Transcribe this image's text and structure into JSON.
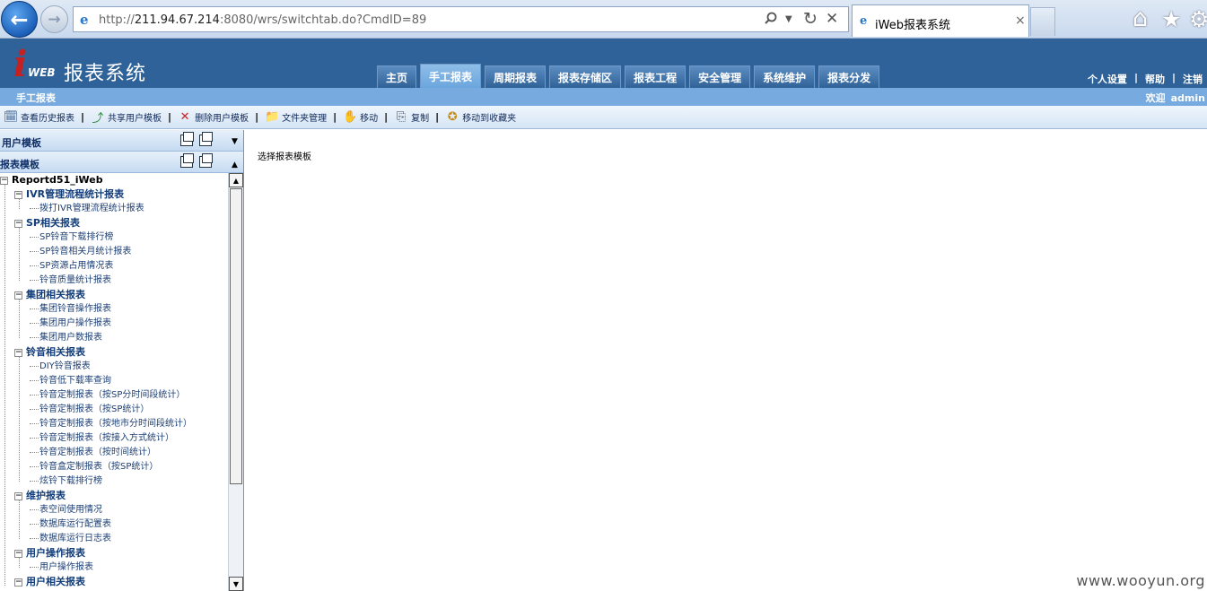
{
  "browser": {
    "url_prefix": "http://",
    "url_host": "211.94.67.214",
    "url_rest": ":8080/wrs/switchtab.do?CmdID=89",
    "tab_title": "iWeb报表系统",
    "tab_close": "×",
    "back": "←",
    "forward": "→",
    "search_icon": "search-icon",
    "refresh": "↻",
    "stop": "✕",
    "home": "⌂",
    "favorites": "★",
    "settings": "⚙"
  },
  "header": {
    "logo_i": "i",
    "logo_web": "WEB",
    "title": "报表系统",
    "nav_tabs": [
      "主页",
      "手工报表",
      "周期报表",
      "报表存储区",
      "报表工程",
      "安全管理",
      "系统维护",
      "报表分发"
    ],
    "active_tab": "手工报表",
    "user_links": [
      "个人设置",
      "|",
      "帮助",
      "|",
      "注销"
    ]
  },
  "subheader": {
    "crumb": "手工报表",
    "welcome": "欢迎",
    "user": "admin"
  },
  "toolbar": {
    "items": [
      {
        "label": "查看历史报表",
        "icon": "history-icon"
      },
      {
        "label": "共享用户模板",
        "icon": "share-icon"
      },
      {
        "label": "删除用户模板",
        "icon": "delete-icon"
      },
      {
        "label": "文件夹管理",
        "icon": "folder-icon"
      },
      {
        "label": "移动",
        "icon": "move-icon"
      },
      {
        "label": "复制",
        "icon": "copy-icon"
      },
      {
        "label": "移动到收藏夹",
        "icon": "favorite-icon"
      }
    ],
    "separator": "|"
  },
  "left": {
    "user_templates": "用户模板",
    "report_templates": "报表模板",
    "tree": {
      "root": "Reportd51_iWeb",
      "groups": [
        {
          "name": "IVR管理流程统计报表",
          "items": [
            "拨打IVR管理流程统计报表"
          ]
        },
        {
          "name": "SP相关报表",
          "items": [
            "SP铃音下载排行榜",
            "SP铃音相关月统计报表",
            "SP资源占用情况表",
            "铃音质量统计报表"
          ]
        },
        {
          "name": "集团相关报表",
          "items": [
            "集团铃音操作报表",
            "集团用户操作报表",
            "集团用户数报表"
          ]
        },
        {
          "name": "铃音相关报表",
          "items": [
            "DIY铃音报表",
            "铃音低下载率查询",
            "铃音定制报表（按SP分时间段统计）",
            "铃音定制报表（按SP统计）",
            "铃音定制报表（按地市分时间段统计）",
            "铃音定制报表（按接入方式统计）",
            "铃音定制报表（按时间统计）",
            "铃音盒定制报表（按SP统计）",
            "炫铃下载排行榜"
          ]
        },
        {
          "name": "维护报表",
          "items": [
            "表空间使用情况",
            "数据库运行配置表",
            "数据库运行日志表"
          ]
        },
        {
          "name": "用户操作报表",
          "items": [
            "用户操作报表"
          ]
        },
        {
          "name": "用户相关报表",
          "items": []
        }
      ]
    }
  },
  "content": {
    "message": "选择报表模板"
  },
  "watermark": "www.wooyun.org",
  "colors": {
    "header_blue": "#2e6299",
    "subheader_blue": "#77abdf",
    "logo_red": "#c62020"
  }
}
